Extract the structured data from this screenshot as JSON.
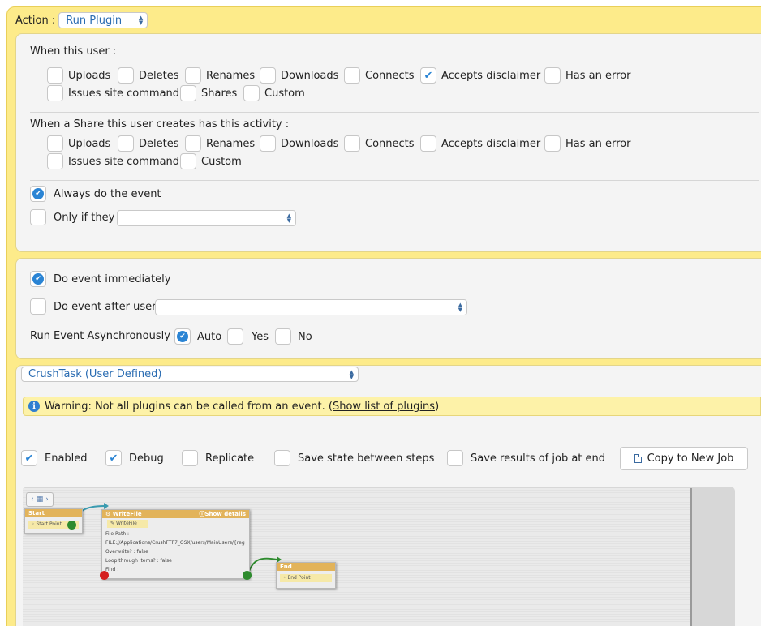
{
  "action": {
    "label": "Action :",
    "selected": "Run Plugin"
  },
  "when_user": {
    "heading": "When this user :",
    "options": [
      {
        "label": "Uploads",
        "checked": false
      },
      {
        "label": "Deletes",
        "checked": false
      },
      {
        "label": "Renames",
        "checked": false
      },
      {
        "label": "Downloads",
        "checked": false
      },
      {
        "label": "Connects",
        "checked": false
      },
      {
        "label": "Accepts disclaimer",
        "checked": true
      },
      {
        "label": "Has an error",
        "checked": false
      },
      {
        "label": "Issues site command",
        "checked": false
      },
      {
        "label": "Shares",
        "checked": false
      },
      {
        "label": "Custom",
        "checked": false
      }
    ]
  },
  "when_share": {
    "heading": "When a Share this user creates has this activity :",
    "options": [
      {
        "label": "Uploads",
        "checked": false
      },
      {
        "label": "Deletes",
        "checked": false
      },
      {
        "label": "Renames",
        "checked": false
      },
      {
        "label": "Downloads",
        "checked": false
      },
      {
        "label": "Connects",
        "checked": false
      },
      {
        "label": "Accepts disclaimer",
        "checked": false
      },
      {
        "label": "Has an error",
        "checked": false
      },
      {
        "label": "Issues site command",
        "checked": false
      },
      {
        "label": "Custom",
        "checked": false
      }
    ]
  },
  "condition": {
    "always": {
      "label": "Always do the event",
      "checked": true
    },
    "only_if": {
      "label": "Only if they",
      "checked": false,
      "value": ""
    }
  },
  "timing": {
    "immediately": {
      "label": "Do event immediately",
      "checked": true
    },
    "after_user": {
      "label": "Do event after user",
      "checked": false,
      "value": ""
    },
    "async_label": "Run Event Asynchronously :",
    "async_options": [
      {
        "label": "Auto",
        "checked": true
      },
      {
        "label": "Yes",
        "checked": false
      },
      {
        "label": "No",
        "checked": false
      }
    ]
  },
  "plugin": {
    "selected": "CrushTask (User Defined)",
    "warning_text": "Warning: Not all plugins can be called from an event. (",
    "warning_link": "Show list of plugins",
    "warning_end": ")"
  },
  "job_options": [
    {
      "label": "Enabled",
      "checked": true
    },
    {
      "label": "Debug",
      "checked": true
    },
    {
      "label": "Replicate",
      "checked": false
    },
    {
      "label": "Save state between steps",
      "checked": false
    },
    {
      "label": "Save results of job at end",
      "checked": false
    }
  ],
  "copy_button": "Copy to New Job",
  "flow": {
    "start": {
      "title": "Start",
      "item": "Start Point"
    },
    "writefile": {
      "title": "WriteFile",
      "show_details": "Show details",
      "item": "WriteFile",
      "file_path_label": "File Path :",
      "file_path_value": "FILE://Applications/CrushFTP7_OSX/users/MainUsers/{reg",
      "overwrite_label": "Overwrite? :",
      "overwrite_value": "false",
      "loop_label": "Loop through items? :",
      "loop_value": "false",
      "find_label": "Find :"
    },
    "end": {
      "title": "End",
      "item": "End Point"
    }
  },
  "colors": {
    "outer_bg": "#fdeb8a",
    "accent_blue": "#2a84d4",
    "node_header": "#e2b35a",
    "port_green": "#2e8b2e",
    "port_red": "#d42020",
    "connector": "#3a9bb0"
  }
}
